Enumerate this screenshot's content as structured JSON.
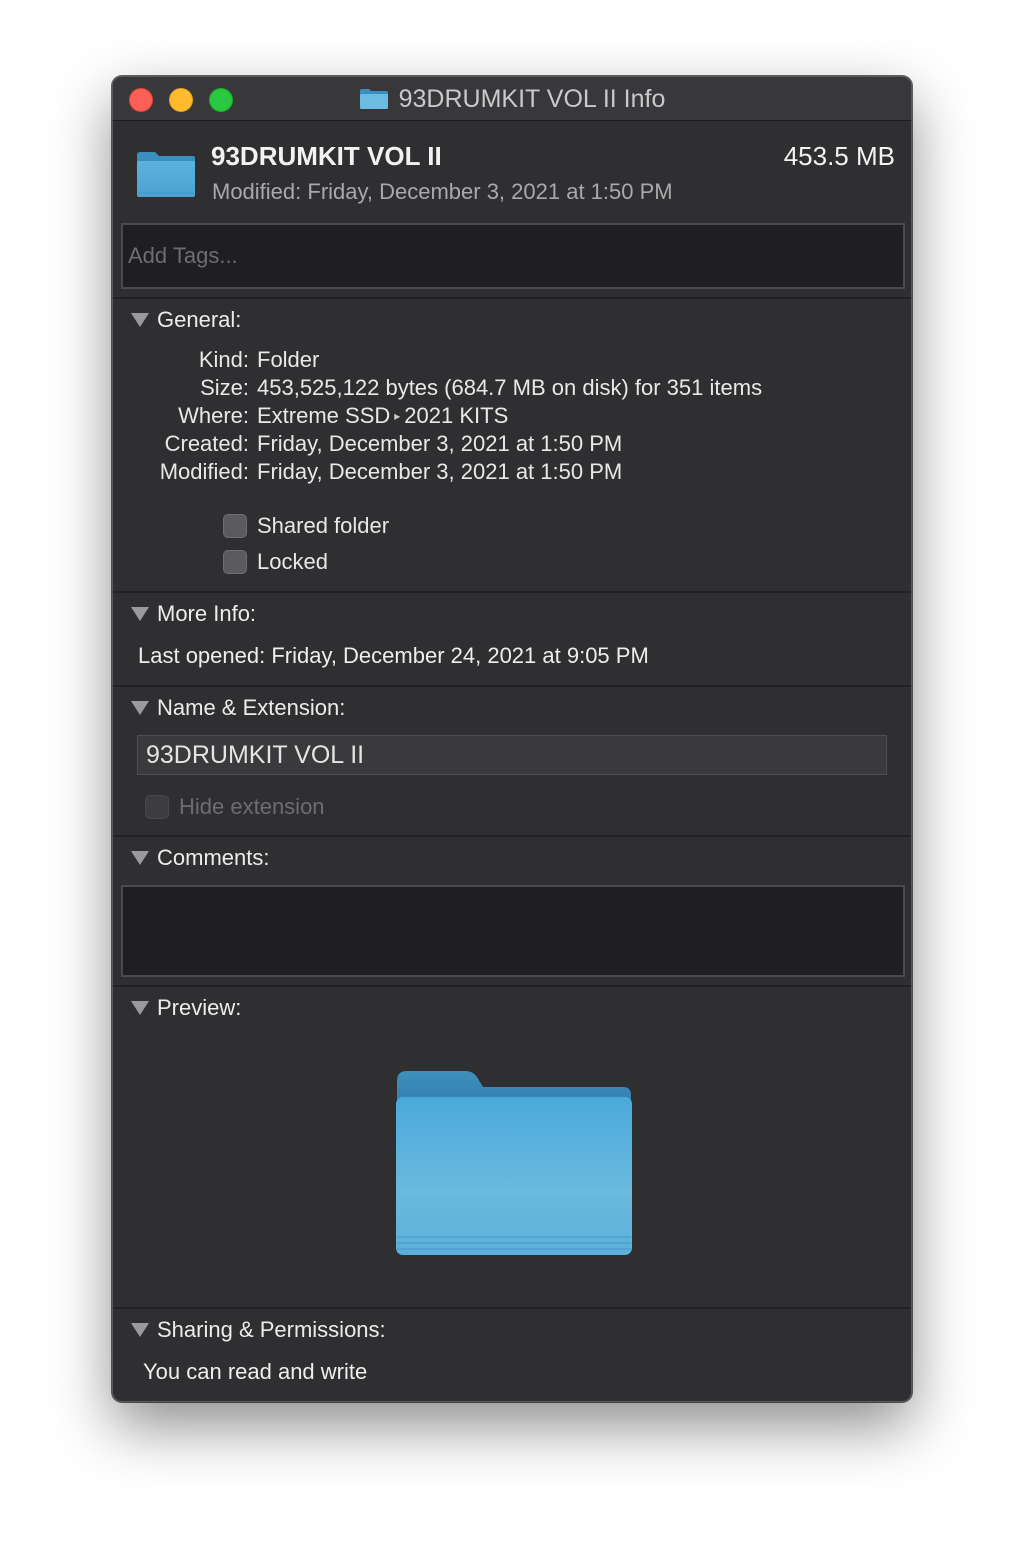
{
  "window": {
    "title": "93DRUMKIT VOL II Info",
    "controls": {
      "close": "close-button",
      "minimize": "minimize-button",
      "zoom": "zoom-button"
    }
  },
  "header": {
    "name": "93DRUMKIT VOL II",
    "size": "453.5 MB",
    "modified": "Modified:  Friday, December 3, 2021 at 1:50 PM",
    "icon": "folder-icon"
  },
  "tags": {
    "placeholder": "Add Tags..."
  },
  "general": {
    "label": "General:",
    "rows": [
      {
        "key": "Kind:",
        "value": "Folder"
      },
      {
        "key": "Size:",
        "value": "453,525,122 bytes (684.7 MB on disk) for 351 items"
      },
      {
        "key": "Where:",
        "path_start": "Extreme SSD",
        "path_sep": "▸",
        "path_end": "2021 KITS"
      },
      {
        "key": "Created:",
        "value": "Friday, December 3, 2021 at 1:50 PM"
      },
      {
        "key": "Modified:",
        "value": "Friday, December 3, 2021 at 1:50 PM"
      }
    ],
    "shared_folder": "Shared folder",
    "locked": "Locked"
  },
  "more_info": {
    "label": "More Info:",
    "last_opened": "Last opened: Friday, December 24, 2021 at 9:05 PM"
  },
  "name_extension": {
    "label": "Name & Extension:",
    "value": "93DRUMKIT VOL II",
    "hide_extension": "Hide extension"
  },
  "comments": {
    "label": "Comments:",
    "value": ""
  },
  "preview": {
    "label": "Preview:",
    "icon": "folder-icon"
  },
  "sharing": {
    "label": "Sharing & Permissions:",
    "status": "You can read and write"
  },
  "colors": {
    "folder_light": "#6cbbe0",
    "folder_dark": "#3b8fbe",
    "window_bg": "#2f2f31",
    "titlebar_bg": "#38383a"
  }
}
